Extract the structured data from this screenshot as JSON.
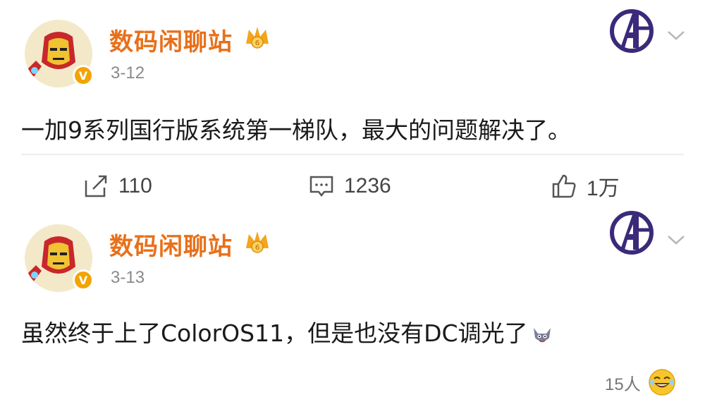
{
  "posts": [
    {
      "username": "数码闲聊站",
      "vip_level": "6",
      "verified_mark": "V",
      "time": "3-12",
      "content": "一加9系列国行版系统第一梯队，最大的问题解决了。",
      "actions": {
        "repost_count": "110",
        "comment_count": "1236",
        "like_count": "1万"
      }
    },
    {
      "username": "数码闲聊站",
      "vip_level": "6",
      "verified_mark": "V",
      "time": "3-13",
      "content": "虽然终于上了ColorOS11，但是也没有DC调光了",
      "reaction_count": "15人"
    }
  ],
  "colors": {
    "username": "#e8701a",
    "verified": "#f2a400",
    "time": "#8a8a8a",
    "avengers": "#3b2a7a"
  },
  "icons": {
    "repost": "share-icon",
    "comment": "comment-icon",
    "like": "thumbs-up-icon",
    "badge": "avengers-badge-icon",
    "more": "chevron-down-icon",
    "reaction": "laughing-emoji-icon"
  }
}
